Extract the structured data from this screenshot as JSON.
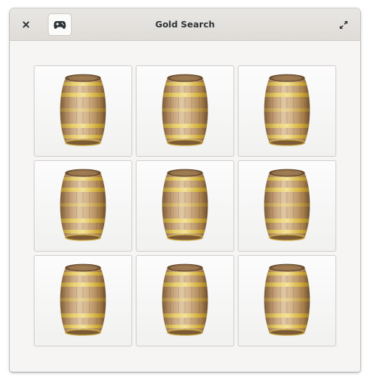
{
  "window": {
    "title": "Gold Search"
  },
  "headerbar": {
    "close_icon": "close-icon",
    "game_icon": "gamepad-icon",
    "fullscreen_icon": "fullscreen-icon"
  },
  "board": {
    "rows": 3,
    "columns": 3,
    "tiles": [
      {
        "icon": "barrel-icon"
      },
      {
        "icon": "barrel-icon"
      },
      {
        "icon": "barrel-icon"
      },
      {
        "icon": "barrel-icon"
      },
      {
        "icon": "barrel-icon"
      },
      {
        "icon": "barrel-icon"
      },
      {
        "icon": "barrel-icon"
      },
      {
        "icon": "barrel-icon"
      },
      {
        "icon": "barrel-icon"
      }
    ]
  },
  "colors": {
    "barrel_wood": "#c9a77a",
    "barrel_hoop": "#d8b84a",
    "headerbar": "#e3e0dc",
    "content_bg": "#f6f5f4"
  }
}
